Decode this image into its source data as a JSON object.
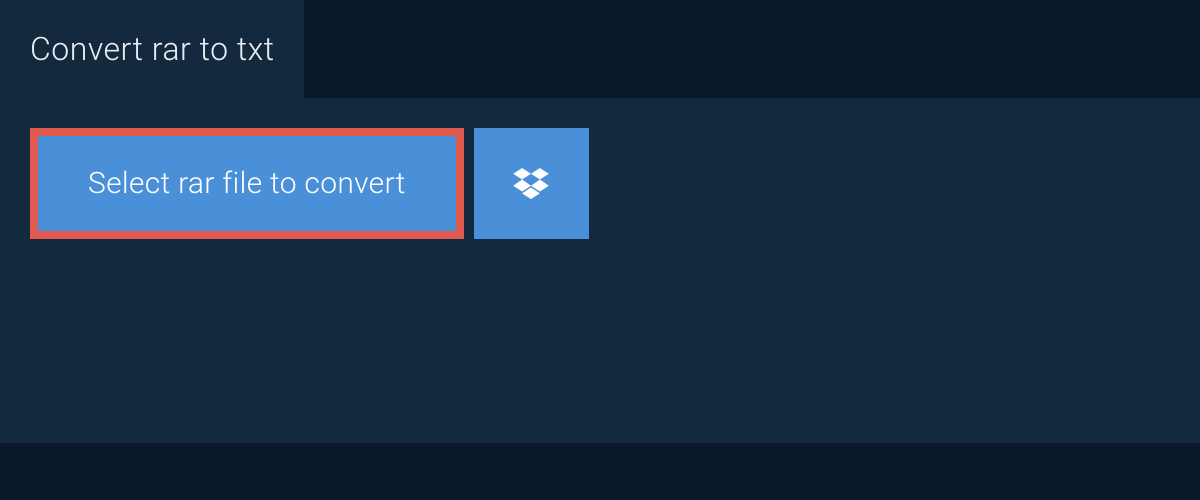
{
  "tab": {
    "title": "Convert rar to txt"
  },
  "actions": {
    "select_file_label": "Select rar file to convert"
  },
  "colors": {
    "background_dark": "#0a1929",
    "panel": "#13293d",
    "button_blue": "#4a90d9",
    "button_border_red": "#e05a4f",
    "text_light": "#e8eef3",
    "text_white": "#ffffff"
  }
}
